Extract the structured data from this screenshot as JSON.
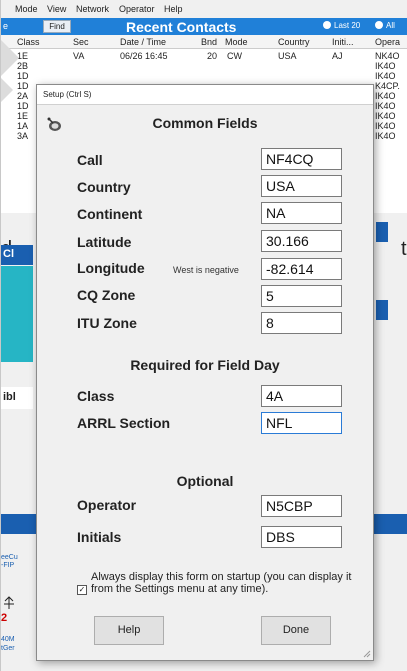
{
  "menu": [
    "Mode",
    "View",
    "Network",
    "Operator",
    "Help"
  ],
  "left_partial": "e",
  "find_label": "Find",
  "recent_contacts_title": "Recent Contacts",
  "radio_last20": "Last 20",
  "radio_all": "All",
  "columns": [
    "Class",
    "Sec",
    "Date  /  Time",
    "Bnd",
    "Mode",
    "Country",
    "Initi...",
    "Opera"
  ],
  "first_row": [
    "1E",
    "VA",
    "06/26  16:45",
    "20",
    "CW",
    "USA",
    "AJ",
    "NK4O"
  ],
  "partial_rows": [
    {
      "cls": "2B",
      "op": "IK4O"
    },
    {
      "cls": "1D",
      "op": "IK4O"
    },
    {
      "cls": "1D",
      "op": "K4CP."
    },
    {
      "cls": "2A",
      "op": "IK4O"
    },
    {
      "cls": "1D",
      "op": "IK4O"
    },
    {
      "cls": "1E",
      "op": "IK4O"
    },
    {
      "cls": "1A",
      "op": "IK4O"
    },
    {
      "cls": "3A",
      "op": "IK4O"
    }
  ],
  "side_labels": {
    "cl": "Cl",
    "ibl": "ibl",
    "d_left": "d",
    "t_right": "t"
  },
  "side_small_text": [
    "eeCu",
    "-FIP",
    "2",
    "40M",
    "tGer"
  ],
  "dialog": {
    "title": "Setup  (Ctrl S)",
    "common_heading": "Common Fields",
    "required_heading": "Required for Field Day",
    "optional_heading": "Optional",
    "longitude_note": "West is negative",
    "fields": {
      "call": {
        "label": "Call",
        "value": "NF4CQ"
      },
      "country": {
        "label": "Country",
        "value": "USA"
      },
      "continent": {
        "label": "Continent",
        "value": "NA"
      },
      "latitude": {
        "label": "Latitude",
        "value": "30.166"
      },
      "longitude": {
        "label": "Longitude",
        "value": "-82.614"
      },
      "cq_zone": {
        "label": "CQ Zone",
        "value": "5"
      },
      "itu_zone": {
        "label": "ITU Zone",
        "value": "8"
      },
      "class": {
        "label": "Class",
        "value": "4A"
      },
      "arrl_section": {
        "label": "ARRL Section",
        "value": "NFL"
      },
      "operator": {
        "label": "Operator",
        "value": "N5CBP"
      },
      "initials": {
        "label": "Initials",
        "value": "DBS"
      }
    },
    "always_display_text": "Always display this form on startup (you can display it from the Settings menu at any time).",
    "always_display_checked": true,
    "check_mark": "✓",
    "help_label": "Help",
    "done_label": "Done"
  },
  "colors": {
    "accent_blue": "#1a5fb0",
    "title_bar": "#2080d8",
    "teal": "#26b5c5"
  }
}
